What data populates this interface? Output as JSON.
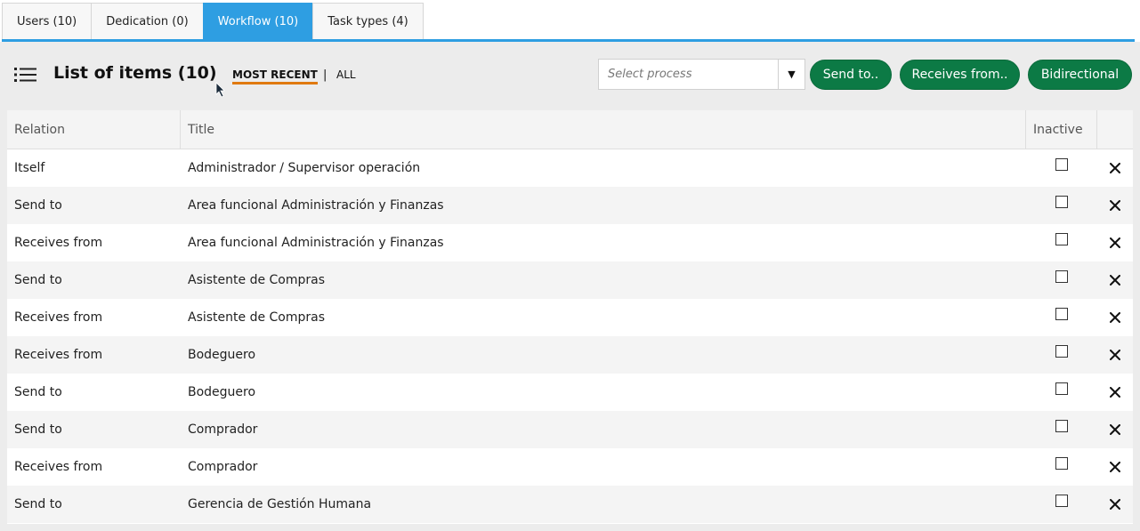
{
  "tabs": [
    {
      "label": "Users (10)",
      "active": false
    },
    {
      "label": "Dedication (0)",
      "active": false
    },
    {
      "label": "Workflow (10)",
      "active": true
    },
    {
      "label": "Task types (4)",
      "active": false
    }
  ],
  "toolbar": {
    "title": "List of items (10)",
    "filter_recent": "MOST RECENT",
    "filter_sep": "|",
    "filter_all": "ALL",
    "select_placeholder": "Select process",
    "select_arrow": "▼",
    "send_to_label": "Send to..",
    "receives_from_label": "Receives from..",
    "bidirectional_label": "Bidirectional"
  },
  "table": {
    "headers": {
      "relation": "Relation",
      "title": "Title",
      "inactive": "Inactive"
    },
    "rows": [
      {
        "relation": "Itself",
        "title": "Administrador / Supervisor operación",
        "inactive": false
      },
      {
        "relation": "Send to",
        "title": "Area funcional Administración y Finanzas",
        "inactive": false
      },
      {
        "relation": "Receives from",
        "title": "Area funcional Administración y Finanzas",
        "inactive": false
      },
      {
        "relation": "Send to",
        "title": "Asistente de Compras",
        "inactive": false
      },
      {
        "relation": "Receives from",
        "title": "Asistente de Compras",
        "inactive": false
      },
      {
        "relation": "Receives from",
        "title": "Bodeguero",
        "inactive": false
      },
      {
        "relation": "Send to",
        "title": "Bodeguero",
        "inactive": false
      },
      {
        "relation": "Send to",
        "title": "Comprador",
        "inactive": false
      },
      {
        "relation": "Receives from",
        "title": "Comprador",
        "inactive": false
      },
      {
        "relation": "Send to",
        "title": "Gerencia de Gestión Humana",
        "inactive": false
      }
    ]
  },
  "colors": {
    "tab_active": "#2e9ee2",
    "pill_green": "#0c7a45",
    "underline_orange": "#e07a10"
  },
  "icons": {
    "list": "list-icon",
    "delete": "close-icon",
    "cursor": "mouse-pointer-icon"
  }
}
